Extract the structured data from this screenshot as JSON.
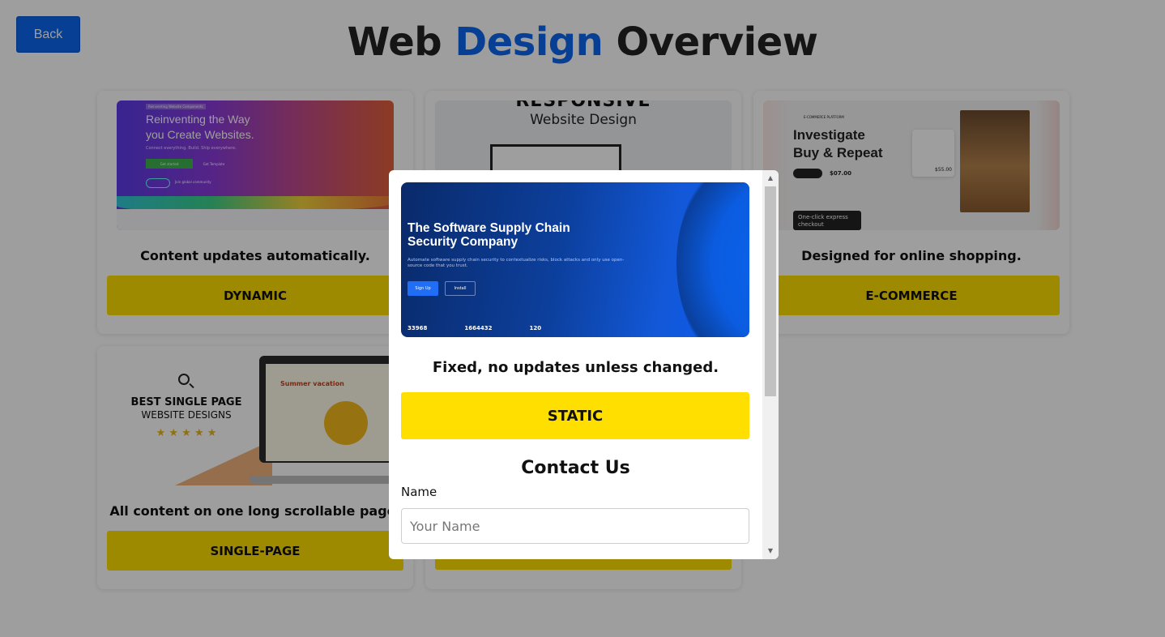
{
  "header": {
    "back_label": "Back",
    "title_part1": "Web ",
    "title_accent": "Design",
    "title_part2": " Overview",
    "accent_color": "#0b66ee"
  },
  "cards": [
    {
      "id": "dynamic",
      "thumb_tag": "Reinventing Website Components",
      "thumb_heading": "Reinventing the Way\nyou Create Websites.",
      "thumb_sub": "Connect everything. Build. Ship everywhere.",
      "thumb_btn1": "Get started",
      "thumb_btn2": "Get Template",
      "thumb_badge": "Join global community",
      "description": "Content updates automatically.",
      "button_label": "DYNAMIC"
    },
    {
      "id": "responsive",
      "thumb_heading": "RESPONSIVE",
      "thumb_sub": "Website Design",
      "description": "",
      "button_label": ""
    },
    {
      "id": "ecommerce",
      "thumb_tag": "E-COMMERCE PLATFORM",
      "thumb_heading": "Investigate\nBuy & Repeat",
      "thumb_price": "$07.00",
      "thumb_price2": "$55.00",
      "thumb_cta": "One-click express checkout",
      "description": "Designed for online shopping.",
      "button_label": "E-COMMERCE"
    },
    {
      "id": "single-page",
      "thumb_heading": "BEST SINGLE PAGE",
      "thumb_sub": "WEBSITE DESIGNS",
      "thumb_stars": "★ ★ ★ ★ ★",
      "thumb_screen_title": "Summer vacation",
      "description": "All content on one long scrollable page.",
      "button_label": "SINGLE-PAGE"
    },
    {
      "id": "fifth",
      "description": "",
      "button_label": ""
    }
  ],
  "modal": {
    "thumb_heading": "The Software Supply Chain\nSecurity Company",
    "thumb_sub": "Automate software supply chain security to contextualize risks, block attacks and only use open-source code that you trust.",
    "thumb_btn1": "Sign Up",
    "thumb_btn2": "Install",
    "thumb_stat1": "33968",
    "thumb_stat2": "1664432",
    "thumb_stat3": "120",
    "description": "Fixed, no updates unless changed.",
    "button_label": "STATIC",
    "contact_title": "Contact Us",
    "name_label": "Name",
    "name_placeholder": "Your Name",
    "name_value": ""
  }
}
